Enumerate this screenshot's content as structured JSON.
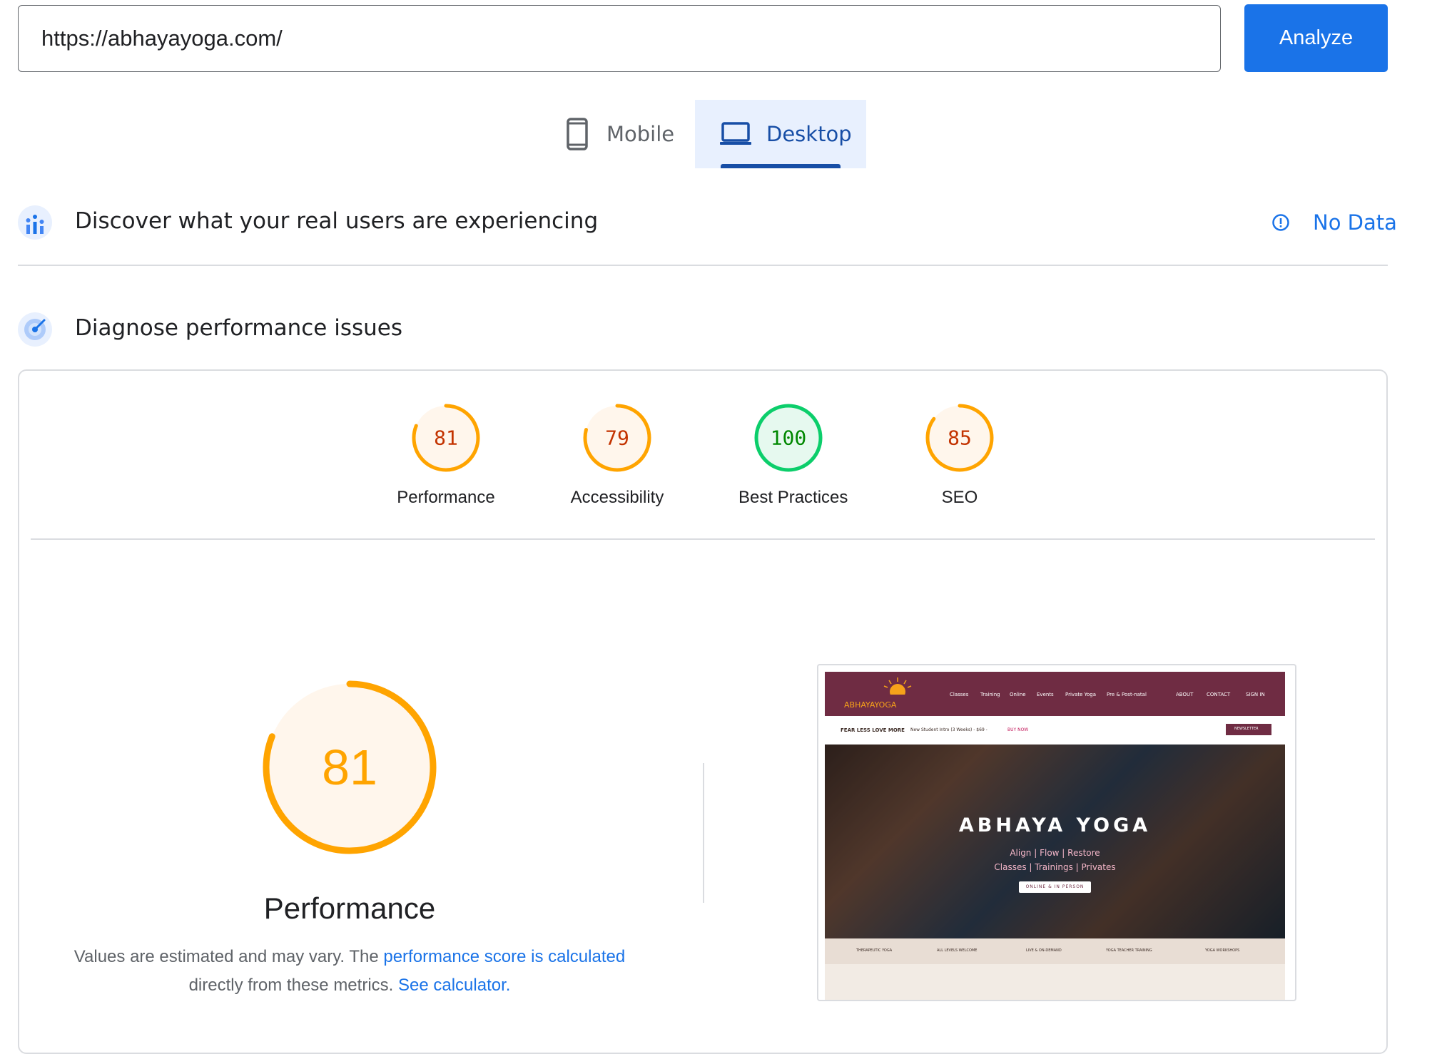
{
  "url_bar": {
    "value": "https://abhayayoga.com/",
    "analyze_label": "Analyze"
  },
  "device_tabs": [
    {
      "label": "Mobile",
      "icon": "smartphone-icon",
      "selected": false
    },
    {
      "label": "Desktop",
      "icon": "laptop-icon",
      "selected": true
    }
  ],
  "field_data": {
    "title": "Discover what your real users are experiencing",
    "status": "No Data",
    "status_icon": "info-icon"
  },
  "lab_data": {
    "title": "Diagnose performance issues"
  },
  "scores": [
    {
      "label": "Performance",
      "value": "81",
      "score": 81,
      "status": "average"
    },
    {
      "label": "Accessibility",
      "value": "79",
      "score": 79,
      "status": "average"
    },
    {
      "label": "Best Practices",
      "value": "100",
      "score": 100,
      "status": "pass"
    },
    {
      "label": "SEO",
      "value": "85",
      "score": 85,
      "status": "average"
    }
  ],
  "colors": {
    "average": "#ffa400",
    "average_bg": "#fff6ec",
    "average_text": "#c33300",
    "pass": "#0cce6b",
    "pass_bg": "#e6f9ef",
    "pass_text": "#008800",
    "accent": "#1a73e8"
  },
  "performance": {
    "value": "81",
    "score": 81,
    "title": "Performance",
    "desc_prefix": "Values are estimated and may vary. The",
    "desc_link": "performance score is calculated",
    "desc_middle": "directly from these metrics.",
    "desc_calc": "See calculator."
  },
  "thumbnail": {
    "brand": "ABHAYAYOGA",
    "nav": [
      "Classes",
      "Training",
      "Online",
      "Events",
      "Private Yoga",
      "Pre & Post-natal"
    ],
    "nav_right": [
      "ABOUT",
      "CONTACT",
      "SIGN IN"
    ],
    "strip_left": "FEAR LESS LOVE MORE",
    "strip_promo": "New Student Intro (3 Weeks) - $69 -",
    "strip_buy": "BUY NOW",
    "strip_btn": "NEWSLETTER",
    "hero_title": "ABHAYA YOGA",
    "hero_line1": "Align | Flow | Restore",
    "hero_line2": "Classes | Trainings | Privates",
    "hero_btn": "ONLINE & IN PERSON",
    "footer": [
      "THERAPEUTIC YOGA",
      "ALL LEVELS WELCOME",
      "LIVE & ON-DEMAND",
      "YOGA TEACHER TRAINING",
      "YOGA WORKSHOPS"
    ]
  }
}
